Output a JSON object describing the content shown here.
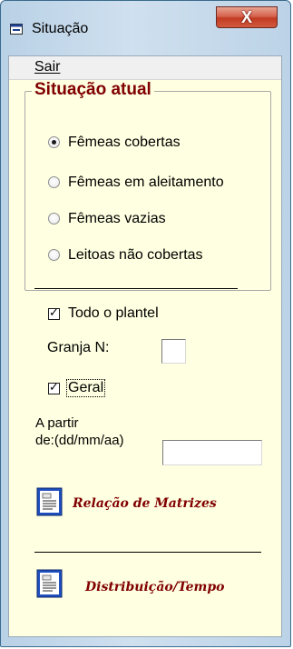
{
  "window": {
    "title": "Situação",
    "close_symbol": "X"
  },
  "menu": {
    "sair_label": "Sair"
  },
  "group": {
    "legend": "Situação atual",
    "options": [
      {
        "label": "Fêmeas cobertas",
        "selected": true
      },
      {
        "label": "Fêmeas em aleitamento",
        "selected": false
      },
      {
        "label": "Fêmeas vazias",
        "selected": false
      },
      {
        "label": "Leitoas não cobertas",
        "selected": false
      }
    ]
  },
  "filters": {
    "todo_plantel_label": "Todo o plantel",
    "todo_plantel_checked": true,
    "granja_label": "Granja N:",
    "granja_value": "",
    "geral_label": "Geral",
    "geral_checked": true,
    "a_partir_label_line1": "A partir",
    "a_partir_label_line2": "de:(dd/mm/aa)",
    "a_partir_value": ""
  },
  "actions": {
    "relacao_label": "Relação de Matrizes",
    "distribuicao_label": "Distribuição/Tempo"
  },
  "colors": {
    "legend": "#800000",
    "action_text": "#800000",
    "client_bg": "#ffffe1"
  }
}
